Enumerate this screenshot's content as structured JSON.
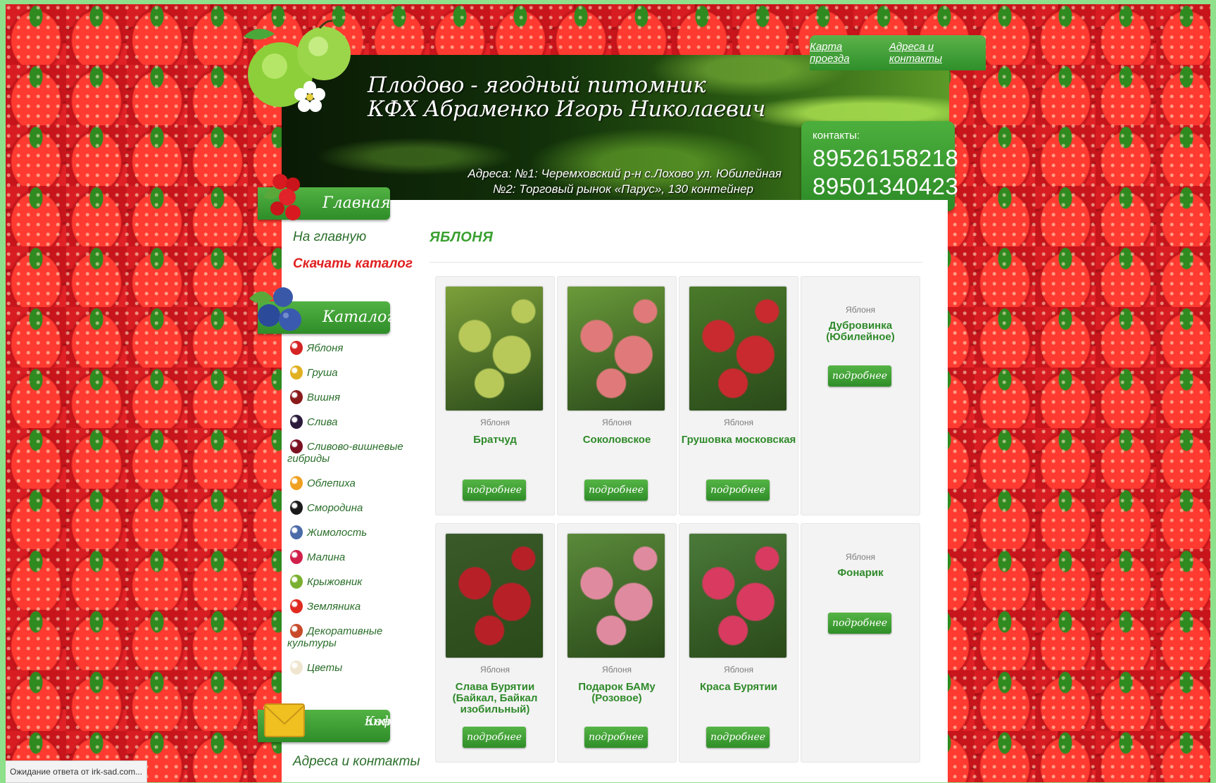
{
  "header": {
    "title_line1": "Плодово - ягодный питомник",
    "title_line2": "КФХ Абраменко Игорь Николаевич",
    "address_line1": "Адреса: №1: Черемховский р-н с.Лохово ул. Юбилейная",
    "address_line2": "№2: Торговый рынок «Парус», 130 контейнер",
    "link_map": "Карта проезда",
    "link_contacts": "Адреса и контакты",
    "contacts_label": "контакты:",
    "phone1": "89526158218",
    "phone2": "89501340423"
  },
  "sidebar": {
    "main_heading": "Главная",
    "link_home": "На главную",
    "link_catalog_download": "Скачать каталог",
    "catalog_heading": "Каталог",
    "catalog_items": [
      {
        "label": "Яблоня",
        "icon": "apple-icon",
        "color": "#d62424"
      },
      {
        "label": "Груша",
        "icon": "pear-icon",
        "color": "#e0b020"
      },
      {
        "label": "Вишня",
        "icon": "cherry-icon",
        "color": "#8a1a1a"
      },
      {
        "label": "Слива",
        "icon": "plum-icon",
        "color": "#2a1a3a"
      },
      {
        "label": "Сливово-вишневые гибриды",
        "icon": "plum-cherry-icon",
        "color": "#7a1020"
      },
      {
        "label": "Облепиха",
        "icon": "sea-buckthorn-icon",
        "color": "#f0a020"
      },
      {
        "label": "Смородина",
        "icon": "currant-icon",
        "color": "#1a1a1a"
      },
      {
        "label": "Жимолость",
        "icon": "honeysuckle-icon",
        "color": "#4a6aa8"
      },
      {
        "label": "Малина",
        "icon": "raspberry-icon",
        "color": "#d0204a"
      },
      {
        "label": "Крыжовник",
        "icon": "gooseberry-icon",
        "color": "#7ab030"
      },
      {
        "label": "Земляника",
        "icon": "strawberry-icon",
        "color": "#e02a20"
      },
      {
        "label": "Декоративные культуры",
        "icon": "decorative-icon",
        "color": "#c84a2a"
      },
      {
        "label": "Цветы",
        "icon": "flower-icon",
        "color": "#f0e6d0"
      }
    ],
    "contact_heading_line1": "Контактная",
    "contact_heading_line2": "информация",
    "link_addresses": "Адреса и контакты"
  },
  "main": {
    "page_title": "ЯБЛОНЯ",
    "button_label": "подробнее",
    "products": [
      {
        "category": "Яблоня",
        "name": "Братчуд",
        "has_image": true,
        "img_color": "#7ca03a",
        "img_color2": "#b8c95a"
      },
      {
        "category": "Яблоня",
        "name": "Соколовское",
        "has_image": true,
        "img_color": "#6a9a3a",
        "img_color2": "#e07a7a"
      },
      {
        "category": "Яблоня",
        "name": "Грушовка московская",
        "has_image": true,
        "img_color": "#4a7a2a",
        "img_color2": "#c82a30"
      },
      {
        "category": "Яблоня",
        "name": "Дубровинка (Юбилейное)",
        "has_image": false
      },
      {
        "category": "Яблоня",
        "name": "Слава Бурятии (Байкал, Байкал изобильный)",
        "has_image": true,
        "img_color": "#3a5a2a",
        "img_color2": "#b82028"
      },
      {
        "category": "Яблоня",
        "name": "Подарок БАМу (Розовое)",
        "has_image": true,
        "img_color": "#5a8a3a",
        "img_color2": "#e08aa0"
      },
      {
        "category": "Яблоня",
        "name": "Краса Бурятии",
        "has_image": true,
        "img_color": "#4a7a3a",
        "img_color2": "#d83a60"
      },
      {
        "category": "Яблоня",
        "name": "Фонарик",
        "has_image": false
      }
    ]
  },
  "statusbar": "Ожидание ответа от irk-sad.com...",
  "colors": {
    "accent_green": "#3aa030",
    "link_red": "#e02020",
    "background_red": "#c8151c"
  }
}
